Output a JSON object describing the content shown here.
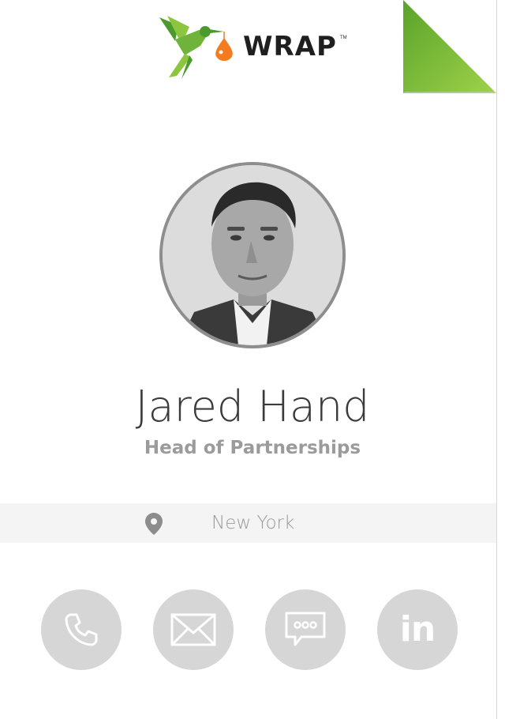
{
  "brand": {
    "wordmark": "WRAP",
    "trademark": "TM",
    "logo_icon": "hummingbird-icon",
    "colors": {
      "bird_light_green": "#8cc63f",
      "bird_dark_green": "#4a9a2e",
      "drop_orange": "#f47b20",
      "corner_fold_green": "#7cbb2e"
    }
  },
  "profile": {
    "name": "Jared Hand",
    "job_title": "Head of Partnerships",
    "photo": "profile-photo"
  },
  "location": {
    "icon": "map-pin-icon",
    "text": "New York"
  },
  "actions": [
    {
      "name": "call",
      "icon": "phone-icon"
    },
    {
      "name": "email",
      "icon": "envelope-icon"
    },
    {
      "name": "message",
      "icon": "chat-bubble-icon"
    },
    {
      "name": "linkedin",
      "icon": "linkedin-icon",
      "glyph": "in"
    }
  ],
  "theme": {
    "action_circle": "#d6d6d6",
    "name_color": "#3b3b3b",
    "subtitle_color": "#9b9b9b",
    "location_bar": "#f4f4f4"
  }
}
